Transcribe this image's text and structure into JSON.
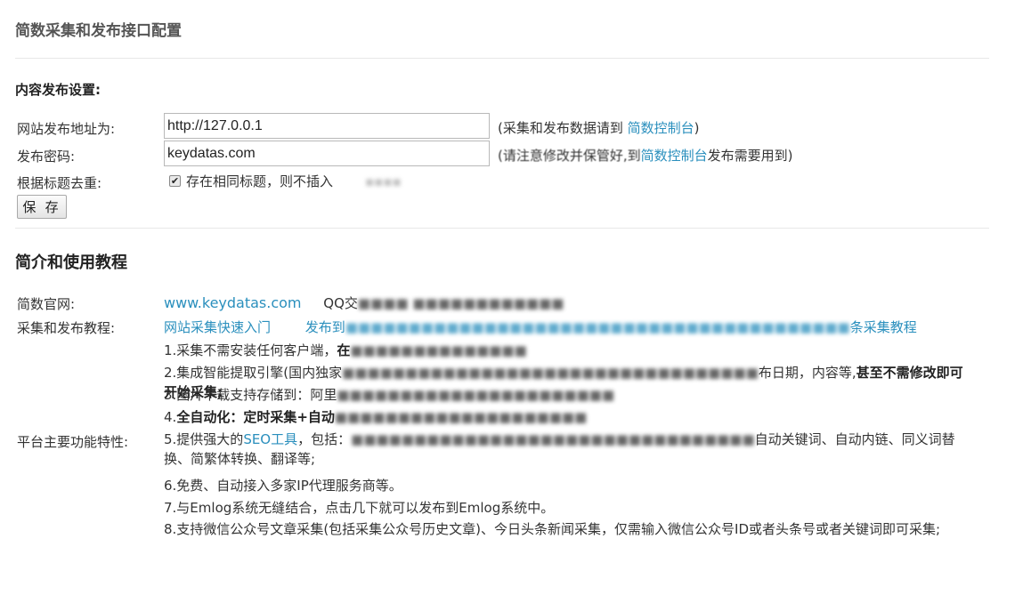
{
  "page": {
    "title": "简数采集和发布接口配置"
  },
  "publish_settings": {
    "title": "内容发布设置:",
    "url_label": "网站发布地址为:",
    "url_value": "http://127.0.0.1",
    "url_hint_prefix": "(采集和发布数据请到 ",
    "url_hint_link": "简数控制台",
    "url_hint_suffix": ")",
    "password_label": "发布密码:",
    "password_value": "keydatas.com",
    "password_hint_prefix": "(请注意修改并保管好,到 ",
    "password_hint_link": "简数控制台",
    "password_hint_suffix": "发布需要用到)",
    "dedupe_label": "根据标题去重:",
    "dedupe_checked": true,
    "dedupe_text": "存在相同标题，则不插入",
    "save_label": "保 存"
  },
  "intro": {
    "title": "简介和使用教程",
    "site_label": "简数官网:",
    "site_link": "www.keydatas.com",
    "qq_text": "QQ交",
    "tutorial_label": "采集和发布教程:",
    "tutorial_link_1": "网站采集快速入门",
    "tutorial_link_2": "发布到",
    "tutorial_link_2_tail": "条采集教程",
    "features_label": "平台主要功能特性:",
    "features": [
      {
        "text": "1.采集不需安装任何客户端，",
        "bold_tail": "在"
      },
      {
        "text": "2.集成智能提取引擎(国内独家",
        "tail": "布日期，内容等,",
        "bold_tail": "甚至不需修改即可开始采集;"
      },
      {
        "text": "3.图片下载支持存储到：阿里"
      },
      {
        "text": "4.",
        "bold_text": "全自动化：定时采集+自动"
      },
      {
        "text": "5.提供强大的",
        "link": "SEO工具",
        "text2": "，包括：",
        "tail": "自动关键词、自动内链、同义词替换、简繁体转换、翻译等;"
      },
      {
        "text": "6.免费、自动接入多家IP代理服务商等。"
      },
      {
        "text": "7.与Emlog系统无缝结合，点击几下就可以发布到Emlog系统中。"
      },
      {
        "text": "8.支持微信公众号文章采集(包括采集公众号历史文章)、今日头条新闻采集，仅需输入微信公众号ID或者头条号或者关键词即可采集;"
      }
    ]
  }
}
